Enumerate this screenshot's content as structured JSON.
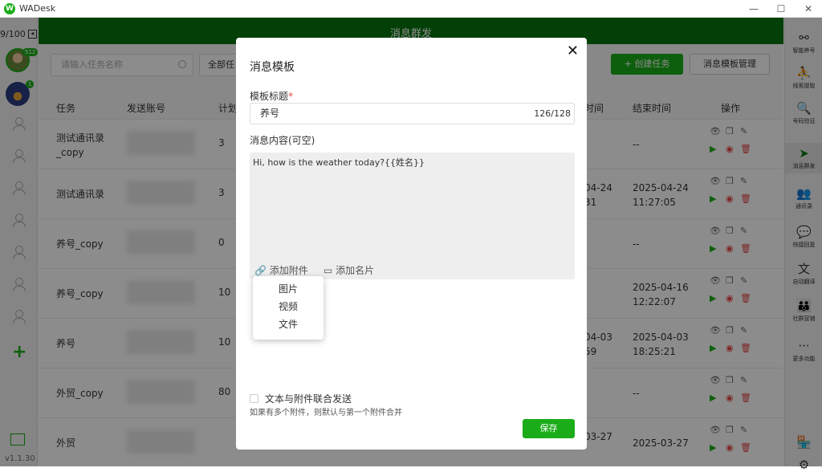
{
  "window": {
    "title": "WADesk",
    "logo_letter": "W",
    "minimize": "—",
    "maximize": "☐",
    "close": "✕"
  },
  "leftbar": {
    "counter": "9/100",
    "counter_icon": "◂",
    "badge1": "512",
    "badge2": "1",
    "plus": "+",
    "version": "v1.1.30"
  },
  "header": {
    "title": "消息群发"
  },
  "toolbar": {
    "search_placeholder": "请输入任务名称",
    "filter": "全部任",
    "create": "+ 创建任务",
    "template_mgmt": "消息模板管理"
  },
  "table": {
    "headers": [
      "任务",
      "发送账号",
      "计划",
      "时间",
      "结束时间",
      "操作"
    ],
    "rows": [
      {
        "task": "测试通讯录\n_copy",
        "count": "3",
        "start": "",
        "end": "--"
      },
      {
        "task": "测试通讯录",
        "count": "3",
        "start": "04-24\n31",
        "end": "2025-04-24\n11:27:05"
      },
      {
        "task": "养号_copy",
        "count": "0",
        "start": "",
        "end": "--"
      },
      {
        "task": "养号_copy",
        "count": "10",
        "start": "",
        "end": "2025-04-16\n12:22:07"
      },
      {
        "task": "养号",
        "count": "10",
        "start": "04-03\n59",
        "end": "2025-04-03\n18:25:21"
      },
      {
        "task": "外贸_copy",
        "count": "80",
        "start": "",
        "end": "--"
      },
      {
        "task": "外贸",
        "count": "",
        "start": "03-27",
        "end": "2025-03-27"
      }
    ]
  },
  "rightbar": {
    "items": [
      {
        "icon": "share-nodes-icon",
        "glyph": "⚯",
        "label": "智能养号"
      },
      {
        "icon": "customer-icon",
        "glyph": "⛹",
        "label": "线索提取"
      },
      {
        "icon": "verify-icon",
        "glyph": "🔍",
        "label": "号码验证"
      },
      {
        "icon": "send-icon",
        "glyph": "➤",
        "label": "消息群发"
      },
      {
        "icon": "contacts-icon",
        "glyph": "👥",
        "label": "通讯录"
      },
      {
        "icon": "quick-reply-icon",
        "glyph": "💬",
        "label": "快捷回复"
      },
      {
        "icon": "translate-icon",
        "glyph": "文",
        "label": "自动翻译"
      },
      {
        "icon": "community-icon",
        "glyph": "👪",
        "label": "社群营销"
      },
      {
        "icon": "more-icon",
        "glyph": "···",
        "label": "更多功能"
      }
    ],
    "store_glyph": "🏪",
    "settings_glyph": "⚙"
  },
  "modal": {
    "title": "消息模板",
    "close": "✕",
    "title_label": "模板标题",
    "required_mark": "*",
    "title_value": "养号",
    "title_counter": "126/128",
    "content_label": "消息内容(可空)",
    "content_value": "Hi, how is the weather today?{{姓名}}",
    "add_attachment": "🔗 添加附件",
    "add_card": "▭ 添加名片",
    "dropdown": [
      "图片",
      "视频",
      "文件"
    ],
    "combine_label": "文本与附件联合发送",
    "hint": "如果有多个附件，则默认与第一个附件合并",
    "save": "保存"
  },
  "colors": {
    "brand": "#1aad19",
    "header": "#07760f"
  }
}
